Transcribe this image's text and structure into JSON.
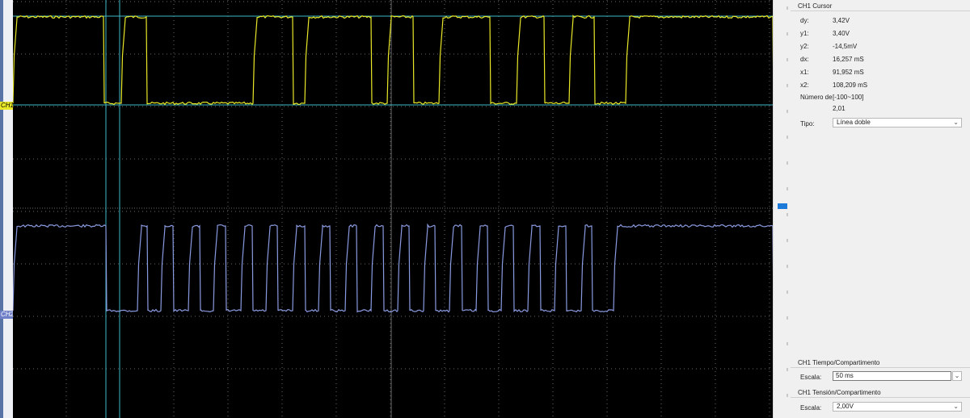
{
  "left_markers": {
    "ch1": "CH1",
    "ch2": "CH2"
  },
  "cursor_panel": {
    "title": "CH1 Cursor",
    "rows": [
      {
        "label": "dy:",
        "value": "3,42V"
      },
      {
        "label": "y1:",
        "value": "3,40V"
      },
      {
        "label": "y2:",
        "value": "-14,5mV"
      },
      {
        "label": "dx:",
        "value": "16,257 mS"
      },
      {
        "label": "x1:",
        "value": "91,952 mS"
      },
      {
        "label": "x2:",
        "value": "108,209 mS"
      }
    ],
    "numero_label": "Número de",
    "numero_range": "[-100~100]",
    "numero_value": "2,01",
    "tipo_label": "Tipo:",
    "tipo_value": "Línea doble"
  },
  "time_panel": {
    "title": "CH1 Tiempo/Compartimento",
    "escala_label": "Escala:",
    "escala_value": "50 ms"
  },
  "volt_panel": {
    "title": "CH1 Tensión/Compartimento",
    "escala_label": "Escala:",
    "escala_value": "2,00V"
  },
  "colors": {
    "ch1": "#e8e828",
    "ch2": "#8a9ae0",
    "cursor": "#3fb7c8",
    "grid": "#6a6a6a",
    "scrollbar_thumb": "#1e7ad8"
  },
  "icons": {
    "dropdown": "chevron-down-icon"
  },
  "waveforms": {
    "ch1_high_intervals": [
      [
        0,
        112
      ],
      [
        134,
        165
      ],
      [
        297,
        346
      ],
      [
        361,
        443
      ],
      [
        463,
        495
      ],
      [
        527,
        590
      ],
      [
        623,
        657
      ],
      [
        688,
        719
      ],
      [
        758,
        940
      ]
    ],
    "ch2_high_intervals": [
      [
        0,
        115
      ],
      [
        154,
        166
      ],
      [
        183,
        198
      ],
      [
        217,
        231
      ],
      [
        248,
        263
      ],
      [
        282,
        296
      ],
      [
        313,
        327
      ],
      [
        346,
        361
      ],
      [
        378,
        392
      ],
      [
        411,
        425
      ],
      [
        443,
        458
      ],
      [
        476,
        490
      ],
      [
        508,
        522
      ],
      [
        540,
        555
      ],
      [
        573,
        587
      ],
      [
        604,
        619
      ],
      [
        637,
        652
      ],
      [
        670,
        684
      ],
      [
        703,
        716
      ],
      [
        743,
        940
      ]
    ]
  }
}
